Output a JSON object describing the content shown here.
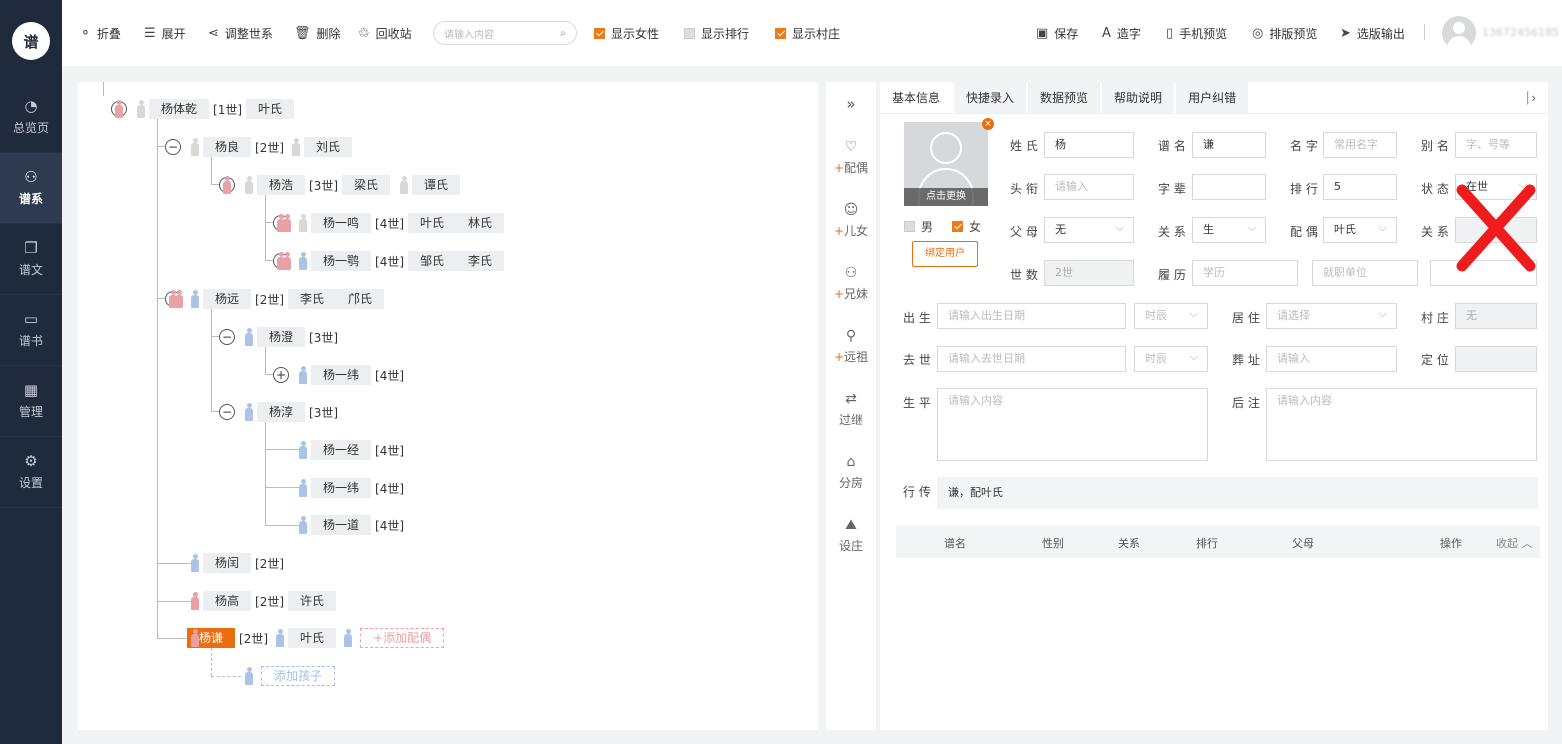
{
  "logo": "谱",
  "nav": [
    {
      "label": "总览页",
      "icon": "◔"
    },
    {
      "label": "谱系",
      "icon": "⚇"
    },
    {
      "label": "谱文",
      "icon": "❐"
    },
    {
      "label": "谱书",
      "icon": "▭"
    },
    {
      "label": "管理",
      "icon": "▦"
    },
    {
      "label": "设置",
      "icon": "⚙"
    }
  ],
  "toolbar": {
    "fold": "折叠",
    "expand": "展开",
    "adjust": "调整世系",
    "delete": "删除",
    "recycle": "回收站",
    "search_placeholder": "请输入内容",
    "show_female": "显示女性",
    "show_rank": "显示排行",
    "show_village": "显示村庄",
    "save": "保存",
    "make_char": "造字",
    "mobile_preview": "手机预览",
    "layout_preview": "排版预览",
    "export": "选版输出",
    "phone": "13672456185"
  },
  "tree": {
    "n1": {
      "name": "杨体乾",
      "gen": "[1世]",
      "spouse": "叶氏"
    },
    "n2": {
      "name": "杨良",
      "gen": "[2世]",
      "spouse": "刘氏"
    },
    "n3": {
      "name": "杨浩",
      "gen": "[3世]",
      "spouse1": "梁氏",
      "spouse2": "谭氏"
    },
    "n4": {
      "name": "杨一鸣",
      "gen": "[4世]",
      "spouse1": "叶氏",
      "spouse2": "林氏"
    },
    "n5": {
      "name": "杨一鹗",
      "gen": "[4世]",
      "spouse1": "邹氏",
      "spouse2": "李氏"
    },
    "n6": {
      "name": "杨远",
      "gen": "[2世]",
      "spouse1": "李氏",
      "spouse2": "邝氏"
    },
    "n7": {
      "name": "杨澄",
      "gen": "[3世]"
    },
    "n8": {
      "name": "杨一纬",
      "gen": "[4世]"
    },
    "n9": {
      "name": "杨淳",
      "gen": "[3世]"
    },
    "n10": {
      "name": "杨一经",
      "gen": "[4世]"
    },
    "n11": {
      "name": "杨一纬",
      "gen": "[4世]"
    },
    "n12": {
      "name": "杨一道",
      "gen": "[4世]"
    },
    "n13": {
      "name": "杨闰",
      "gen": "[2世]"
    },
    "n14": {
      "name": "杨高",
      "gen": "[2世]",
      "spouse": "许氏"
    },
    "n15": {
      "name": "杨谦",
      "gen": "[2世]",
      "spouse": "叶氏",
      "add_spouse": "+添加配偶"
    },
    "add_child": "添加孩子"
  },
  "quick": [
    {
      "label": "配偶",
      "icon": "♡",
      "plus": "+"
    },
    {
      "label": "儿女",
      "icon": "☺",
      "plus": "+"
    },
    {
      "label": "兄妹",
      "icon": "⚇",
      "plus": "+"
    },
    {
      "label": "远祖",
      "icon": "⚲",
      "plus": "+"
    },
    {
      "label": "过继",
      "icon": "⇄",
      "plus": ""
    },
    {
      "label": "分房",
      "icon": "⌂",
      "plus": ""
    },
    {
      "label": "设庄",
      "icon": "⛰",
      "plus": ""
    }
  ],
  "panel": {
    "tabs": [
      "基本信息",
      "快捷录入",
      "数据预览",
      "帮助说明",
      "用户纠错"
    ],
    "photo_caption": "点击更换",
    "male": "男",
    "female": "女",
    "bind_user": "绑定用户",
    "labels": {
      "surname": "姓 氏",
      "pu_name": "谱 名",
      "given": "名 字",
      "alias": "别 名",
      "title": "头 衔",
      "zibei": "字 辈",
      "rank": "排 行",
      "status": "状 态",
      "parents": "父 母",
      "relation": "关 系",
      "spouse": "配 偶",
      "relation2": "关 系",
      "gen": "世 数",
      "resume": "履 历",
      "birth": "出 生",
      "live": "居 住",
      "village": "村 庄",
      "death": "去 世",
      "burial": "葬 址",
      "locate": "定 位",
      "life": "生 平",
      "note": "后 注",
      "xingzhuan": "行 传"
    },
    "values": {
      "surname": "杨",
      "pu_name": "谦",
      "rank": "5",
      "status": "在世",
      "parents": "无",
      "relation": "生",
      "spouse": "叶氏",
      "gen": "2世",
      "village": "无",
      "xingzhuan": "谦，配叶氏"
    },
    "placeholders": {
      "given": "常用名字",
      "alias": "字、号等",
      "title": "请输入",
      "edu": "学历",
      "work": "就职单位",
      "birth": "请输入出生日期",
      "shichen": "时辰",
      "live": "请选择",
      "death": "请输入去世日期",
      "shichen2": "时辰",
      "burial": "请输入",
      "life": "请输入内容",
      "note": "请输入内容"
    },
    "table": {
      "pu_name": "谱名",
      "sex": "性别",
      "relation": "关系",
      "rank": "排行",
      "parents": "父母",
      "op": "操作",
      "collapse": "收起 ︿"
    }
  }
}
